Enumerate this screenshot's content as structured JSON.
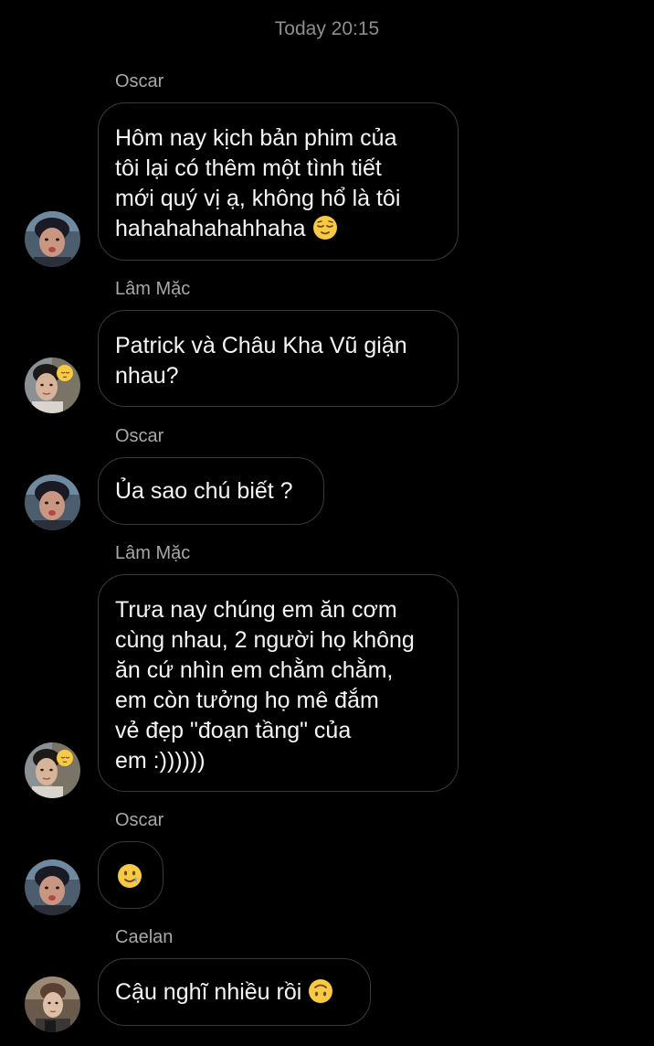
{
  "header": {
    "timestamp": "Today 20:15"
  },
  "messages": [
    {
      "sender": "Oscar",
      "text": "Hôm nay kịch bản phim của\ntôi lại có thêm một tình tiết\nmới quý vị ạ, không hổ là tôi\nhahahahahahhaha",
      "emoji": "relieved-face"
    },
    {
      "sender": "Lâm Mặc",
      "text": "Patrick và Châu Kha Vũ giận\nnhau?"
    },
    {
      "sender": "Oscar",
      "text": "Ủa sao chú biết ?"
    },
    {
      "sender": "Lâm Mặc",
      "text": "Trưa nay chúng em ăn cơm\ncùng nhau, 2 người họ không\năn cứ nhìn em chằm chằm,\nem còn tưởng họ mê đắm\nvẻ đẹp \"đoạn tầng\" của\nem :))))))"
    },
    {
      "sender": "Oscar",
      "text": "",
      "emoji": "smiling-face-with-tear"
    },
    {
      "sender": "Caelan",
      "text": "Cậu nghĩ nhiều rồi",
      "emoji": "upside-down-face"
    }
  ],
  "colors": {
    "background": "#000000",
    "bubble_border": "#3a3a3a",
    "sender_name": "#a8a8a8",
    "timestamp": "#8e8e8e",
    "emoji_yellow": "#f7c944"
  }
}
